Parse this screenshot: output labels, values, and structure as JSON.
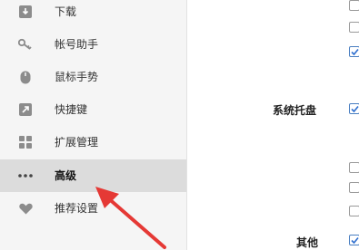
{
  "sidebar": {
    "items": [
      {
        "icon": "download-icon",
        "label": "下载",
        "active": false
      },
      {
        "icon": "key-icon",
        "label": "帐号助手",
        "active": false
      },
      {
        "icon": "mouse-icon",
        "label": "鼠标手势",
        "active": false
      },
      {
        "icon": "shortcut-arrow-icon",
        "label": "快捷键",
        "active": false
      },
      {
        "icon": "extensions-grid-icon",
        "label": "扩展管理",
        "active": false
      },
      {
        "icon": "more-dots-icon",
        "label": "高级",
        "active": true
      },
      {
        "icon": "recommend-heart-icon",
        "label": "推荐设置",
        "active": false
      }
    ]
  },
  "content": {
    "section_system_tray": "系统托盘",
    "section_other": "其他",
    "checkboxes": [
      {
        "checked": false
      },
      {
        "checked": false
      },
      {
        "checked": true
      },
      {
        "checked": true
      },
      {
        "checked": false
      },
      {
        "checked": false
      },
      {
        "checked": false
      },
      {
        "checked": true
      }
    ]
  },
  "colors": {
    "sidebar_bg": "#f5f5f5",
    "active_bg": "#dcdcdc",
    "checkbox_accent": "#4a7fc1",
    "annotation_arrow": "#e53935"
  }
}
